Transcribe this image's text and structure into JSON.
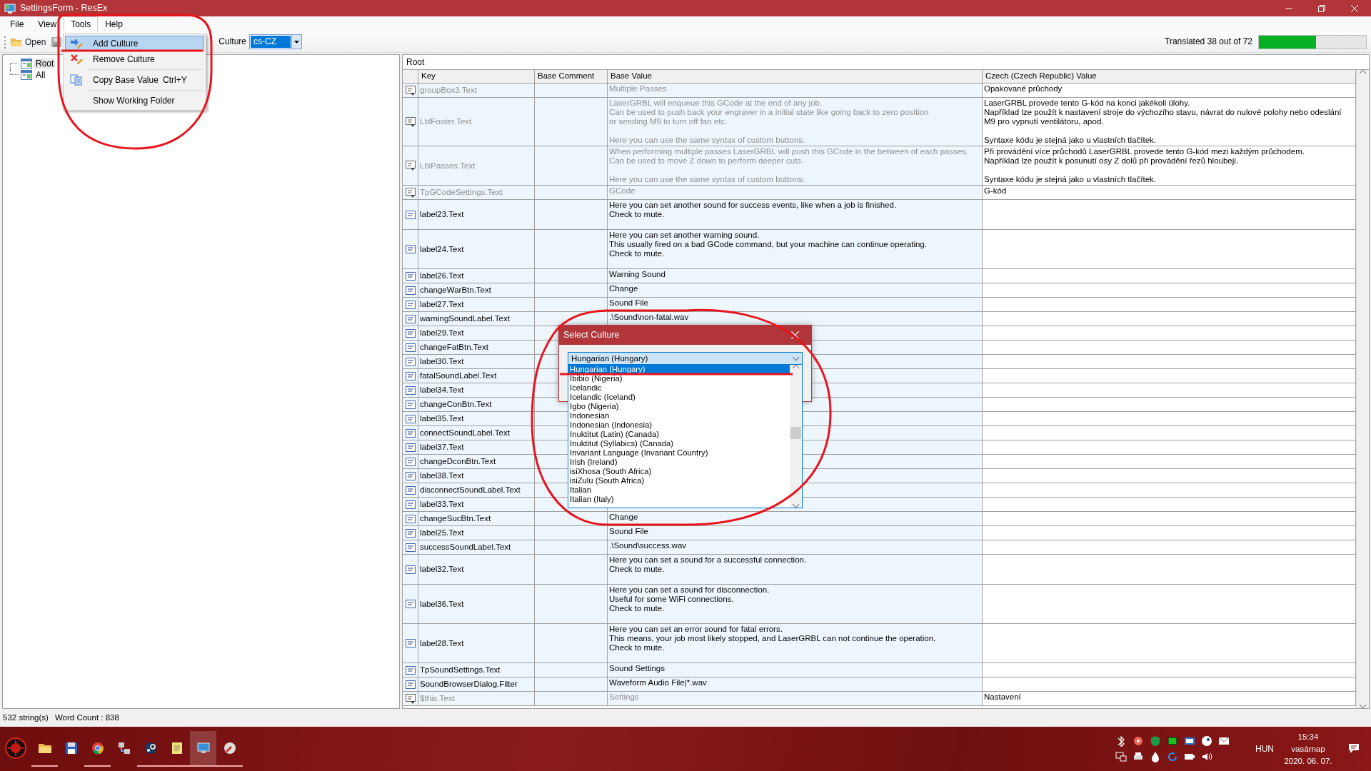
{
  "window": {
    "title": "SettingsForm - ResEx"
  },
  "menu": [
    {
      "label": "File",
      "selected": false
    },
    {
      "label": "View",
      "selected": false
    },
    {
      "label": "Tools",
      "selected": true
    },
    {
      "label": "Help",
      "selected": false
    }
  ],
  "tools_menu": [
    {
      "kind": "add",
      "label": "Add Culture",
      "selected": true
    },
    {
      "kind": "remove",
      "label": "Remove Culture",
      "selected": false
    },
    {
      "kind": "separator"
    },
    {
      "kind": "copy",
      "label": "Copy Base Value",
      "shortcut": "Ctrl+Y",
      "selected": false
    },
    {
      "kind": "separator"
    },
    {
      "kind": "plain",
      "label": "Show Working Folder",
      "selected": false
    }
  ],
  "toolbar": {
    "open": "Open",
    "culture_label": "Culture",
    "culture_value": "cs-CZ",
    "progress_text": "Translated 38 out of 72",
    "level": 0.53
  },
  "tree": [
    {
      "label": "Root",
      "selected": true
    },
    {
      "label": "All",
      "selected": false
    }
  ],
  "grid": {
    "title": "Root",
    "columns": [
      "Key",
      "Base Comment",
      "Base Value",
      "Czech (Czech Republic) Value"
    ],
    "rows": [
      {
        "key": "groupBox3.Text",
        "translated": true,
        "base_value": "Multiple Passes",
        "value": "Opakované průchody"
      },
      {
        "key": "LblFooter.Text",
        "translated": true,
        "base_value": "LaserGRBL will enqueue this GCode at the end of any job.\nCan be used to push back your engraver in a initial state like going back to zero position\nor sending M9 to turn off fan etc.\n\nHere you can use the same syntax of custom buttons.",
        "value": "LaserGRBL provede tento G-kód na konci jakékoli úlohy.\nNapříklad lze použít k nastavení stroje do výchozího stavu, návrat do nulové polohy nebo odeslání M9 pro vypnutí ventilátoru, apod.\n\nSyntaxe kódu je stejná jako u vlastních tlačítek."
      },
      {
        "key": "LblPasses.Text",
        "translated": true,
        "base_value": "When performing multiple passes LaserGRBL will push this GCode in the between of each passes.\nCan be used to move Z down to perform deeper cuts.\n\nHere you can use the same syntax of custom buttons.",
        "value": "Při provádění více průchodů LaserGRBL provede tento G-kód mezi každým průchodem.\nNapříklad lze použít k posunutí osy Z dolů při provádění řezů hloubeji.\n\nSyntaxe kódu je stejná jako u vlastních tlačítek."
      },
      {
        "key": "TpGCodeSettings.Text",
        "translated": true,
        "base_value": "GCode",
        "value": "G-kód"
      },
      {
        "key": "label23.Text",
        "translated": false,
        "base_value": "Here you can set another sound for success events, like when a job is finished.\nCheck to mute."
      },
      {
        "key": "label24.Text",
        "translated": false,
        "base_value": "Here you can set another warning sound.\nThis usually fired on a bad GCode command, but your machine can continue operating.\nCheck to mute."
      },
      {
        "key": "label26.Text",
        "translated": false,
        "base_value": "Warning Sound"
      },
      {
        "key": "changeWarBtn.Text",
        "translated": false,
        "base_value": "Change"
      },
      {
        "key": "label27.Text",
        "translated": false,
        "base_value": "Sound File"
      },
      {
        "key": "warningSoundLabel.Text",
        "translated": false,
        "base_value": ".\\Sound\\non-fatal.wav"
      },
      {
        "key": "label29.Text",
        "translated": false
      },
      {
        "key": "changeFatBtn.Text",
        "translated": false
      },
      {
        "key": "label30.Text",
        "translated": false
      },
      {
        "key": "fatalSoundLabel.Text",
        "translated": false
      },
      {
        "key": "label34.Text",
        "translated": false
      },
      {
        "key": "changeConBtn.Text",
        "translated": false
      },
      {
        "key": "label35.Text",
        "translated": false
      },
      {
        "key": "connectSoundLabel.Text",
        "translated": false
      },
      {
        "key": "label37.Text",
        "translated": false
      },
      {
        "key": "changeDconBtn.Text",
        "translated": false
      },
      {
        "key": "label38.Text",
        "translated": false
      },
      {
        "key": "disconnectSoundLabel.Text",
        "translated": false
      },
      {
        "key": "label33.Text",
        "translated": false
      },
      {
        "key": "changeSucBtn.Text",
        "translated": false,
        "base_value": "Change"
      },
      {
        "key": "label25.Text",
        "translated": false,
        "base_value": "Sound File"
      },
      {
        "key": "successSoundLabel.Text",
        "translated": false,
        "base_value": ".\\Sound\\success.wav"
      },
      {
        "key": "label32.Text",
        "translated": false,
        "base_value": "Here you can set a sound for a successful connection.\nCheck to mute."
      },
      {
        "key": "label36.Text",
        "translated": false,
        "base_value": "Here you can set a sound for disconnection.\nUseful for some WiFi connections.\nCheck to mute."
      },
      {
        "key": "label28.Text",
        "translated": false,
        "base_value": "Here you can set an error sound for fatal errors.\nThis means, your job most likely stopped, and LaserGRBL can not continue the operation.\nCheck to mute."
      },
      {
        "key": "TpSoundSettings.Text",
        "translated": false,
        "base_value": "Sound Settings"
      },
      {
        "key": "SoundBrowserDialog.Filter",
        "translated": false,
        "base_value": "Waveform Audio File|*.wav"
      },
      {
        "key": "$this.Text",
        "translated": true,
        "base_value": "Settings",
        "value": "Nastavení"
      }
    ]
  },
  "status": {
    "strings": "532 string(s)",
    "word_count": "Word Count : 838"
  },
  "dialog": {
    "title": "Select Culture",
    "combo_value": "Hungarian (Hungary)",
    "options": [
      {
        "label": "Hungarian (Hungary)",
        "selected": true
      },
      {
        "label": "Ibibio (Nigeria)",
        "selected": false
      },
      {
        "label": "Icelandic",
        "selected": false
      },
      {
        "label": "Icelandic (Iceland)",
        "selected": false
      },
      {
        "label": "Igbo (Nigeria)",
        "selected": false
      },
      {
        "label": "Indonesian",
        "selected": false
      },
      {
        "label": "Indonesian (Indonesia)",
        "selected": false
      },
      {
        "label": "Inuktitut (Latin) (Canada)",
        "selected": false
      },
      {
        "label": "Inuktitut (Syllabics) (Canada)",
        "selected": false
      },
      {
        "label": "Invariant Language (Invariant Country)",
        "selected": false
      },
      {
        "label": "Irish (Ireland)",
        "selected": false
      },
      {
        "label": "isiXhosa (South Africa)",
        "selected": false
      },
      {
        "label": "isiZulu (South Africa)",
        "selected": false
      },
      {
        "label": "Italian",
        "selected": false
      },
      {
        "label": "Italian (Italy)",
        "selected": false
      }
    ]
  },
  "taskbar": {
    "apps": [
      {
        "kind": "folder",
        "running": true,
        "selected": false
      },
      {
        "kind": "disk",
        "running": false,
        "selected": false
      },
      {
        "kind": "browser",
        "running": true,
        "selected": false
      },
      {
        "kind": "network",
        "running": false,
        "selected": false
      },
      {
        "kind": "steam",
        "running": true,
        "selected": false
      },
      {
        "kind": "notes",
        "running": true,
        "selected": false
      },
      {
        "kind": "monitor",
        "running": true,
        "selected": true
      },
      {
        "kind": "tool",
        "running": true,
        "selected": false
      }
    ],
    "language": "HUN",
    "time": "15:34",
    "day": "vasárnap",
    "date": "2020. 06. 07."
  }
}
